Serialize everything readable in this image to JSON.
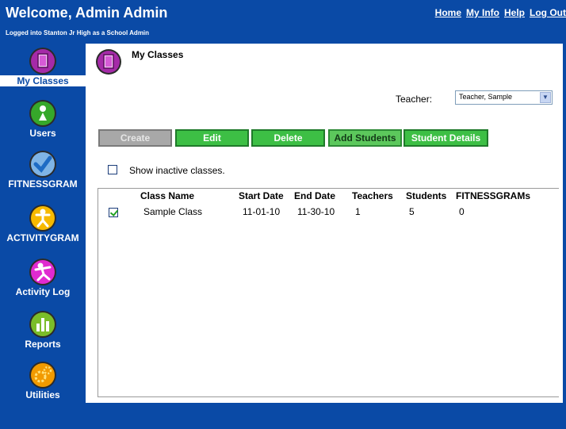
{
  "header": {
    "title": "Welcome, Admin Admin",
    "subtitle": "Logged into Stanton Jr High as a School Admin",
    "links": [
      "Home",
      "My Info",
      "Help",
      "Log Out"
    ]
  },
  "sidebar": {
    "items": [
      {
        "label": "My Classes",
        "icon": "classroom-door-icon",
        "color": "#9b1fa0",
        "active": true
      },
      {
        "label": "Users",
        "icon": "user-icon",
        "color": "#3aaa2a"
      },
      {
        "label": "FITNESSGRAM",
        "icon": "checkmark-icon",
        "color": "#3b8fd9"
      },
      {
        "label": "ACTIVITYGRAM",
        "icon": "activity-figure-icon",
        "color": "#f5b800"
      },
      {
        "label": "Activity Log",
        "icon": "activity-log-figure-icon",
        "color": "#e02ad0"
      },
      {
        "label": "Reports",
        "icon": "bar-chart-icon",
        "color": "#7bbd2a"
      },
      {
        "label": "Utilities",
        "icon": "gears-icon",
        "color": "#f29a00"
      }
    ]
  },
  "main": {
    "title": "My Classes",
    "teacher_label": "Teacher:",
    "teacher_select_value": "Teacher, Sample",
    "buttons": {
      "create": "Create",
      "edit": "Edit",
      "delete": "Delete",
      "add_students": "Add Students",
      "student_details": "Student Details"
    },
    "show_inactive_label": "Show inactive classes.",
    "show_inactive_checked": false,
    "table": {
      "columns": [
        "Class Name",
        "Start Date",
        "End Date",
        "Teachers",
        "Students",
        "FITNESSGRAMs"
      ],
      "rows": [
        {
          "checked": true,
          "cells": [
            "Sample Class",
            "11-01-10",
            "11-30-10",
            "1",
            "5",
            "0"
          ]
        }
      ]
    }
  },
  "colors": {
    "background": "#0a4aa6",
    "button_green": "#3dbf45",
    "button_disabled": "#a8a8a8"
  }
}
